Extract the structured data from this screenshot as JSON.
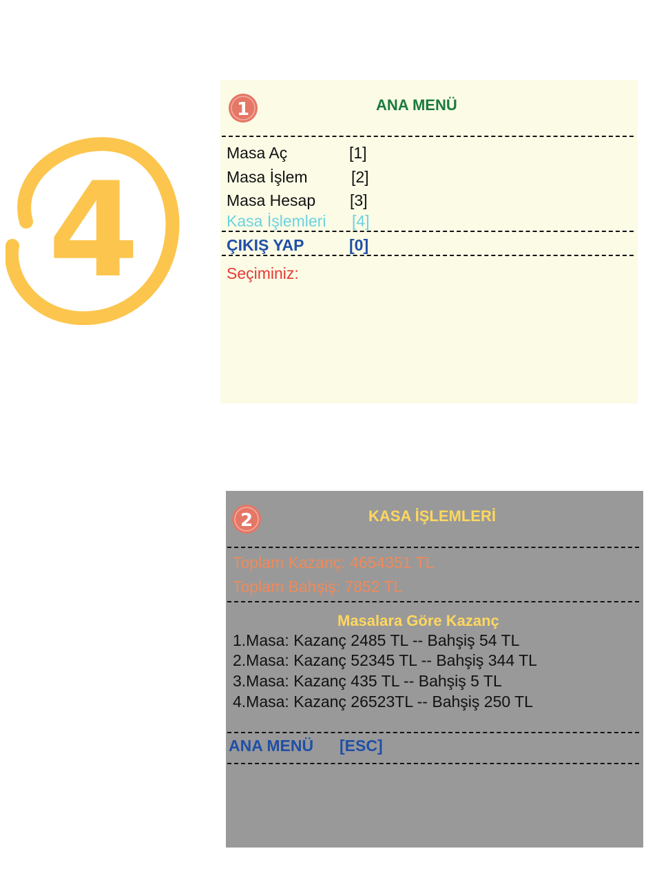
{
  "step_number": "4",
  "colors": {
    "step_circle": "#fcc54d",
    "badge": "#e57766",
    "panel1_bg": "#fbfbe6",
    "panel2_bg": "#999999",
    "green_title": "#1b7a3c",
    "blue": "#1f4fa7",
    "cyan": "#6bd3e0",
    "red": "#e53935",
    "orange": "#f08a5a",
    "yellow": "#ffd75e"
  },
  "menu": {
    "badge_number": "1",
    "title": "ANA MENÜ",
    "items": [
      {
        "label": "Masa Aç",
        "key": "[1]"
      },
      {
        "label": "Masa İşlem",
        "key": "[2]"
      },
      {
        "label": "Masa Hesap",
        "key": "[3]"
      },
      {
        "label": "Kasa İşlemleri",
        "key": "[4]"
      }
    ],
    "exit": {
      "label": "ÇIKIŞ YAP",
      "key": "[0]"
    },
    "prompt": "Seçiminiz:"
  },
  "kasa": {
    "badge_number": "2",
    "title": "KASA İŞLEMLERİ",
    "total_earnings": "Toplam Kazanç: 4654351 TL",
    "total_tips": "Toplam Bahşiş: 7852 TL",
    "section_title": "Masalara Göre Kazanç",
    "tables": [
      "1.Masa: Kazanç 2485 TL  --  Bahşiş 54 TL",
      "2.Masa: Kazanç 52345 TL  --  Bahşiş 344 TL",
      "3.Masa: Kazanç 435 TL  --  Bahşiş 5 TL",
      "4.Masa: Kazanç 26523TL  --  Bahşiş 250 TL"
    ],
    "back": {
      "label": "ANA MENÜ",
      "key": "[ESC]"
    }
  }
}
